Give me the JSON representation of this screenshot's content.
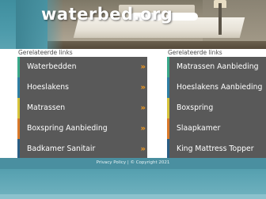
{
  "header": {
    "logo_text": "waterbed.org"
  },
  "columns": [
    {
      "title": "Gerelateerde links",
      "links": [
        {
          "label": "Waterbedden",
          "accent": "#3aa88a",
          "chevron": true
        },
        {
          "label": "Hoeslakens",
          "accent": "#2f7fa3",
          "chevron": true
        },
        {
          "label": "Matrassen",
          "accent": "#d6c33a",
          "chevron": true
        },
        {
          "label": "Boxspring Aanbieding",
          "accent": "#d9792a",
          "chevron": true
        },
        {
          "label": "Badkamer Sanitair",
          "accent": "#2a5d83",
          "chevron": true
        }
      ]
    },
    {
      "title": "Gerelateerde links",
      "links": [
        {
          "label": "Matrassen Aanbieding",
          "accent": "#3aa88a"
        },
        {
          "label": "Hoeslakens Aanbieding",
          "accent": "#2f7fa3"
        },
        {
          "label": "Boxspring",
          "accent": "#d6c33a"
        },
        {
          "label": "Slaapkamer",
          "accent": "#d9792a"
        },
        {
          "label": "King Mattress Topper",
          "accent": "#2a5d83"
        }
      ]
    }
  ],
  "chevron_glyph": "»",
  "footer": {
    "text": "Privacy Policy | © Copyright 2021"
  },
  "colors": {
    "header_teal": "#4c9aaa",
    "link_bg": "#595959",
    "chevron": "#f29a1f"
  }
}
